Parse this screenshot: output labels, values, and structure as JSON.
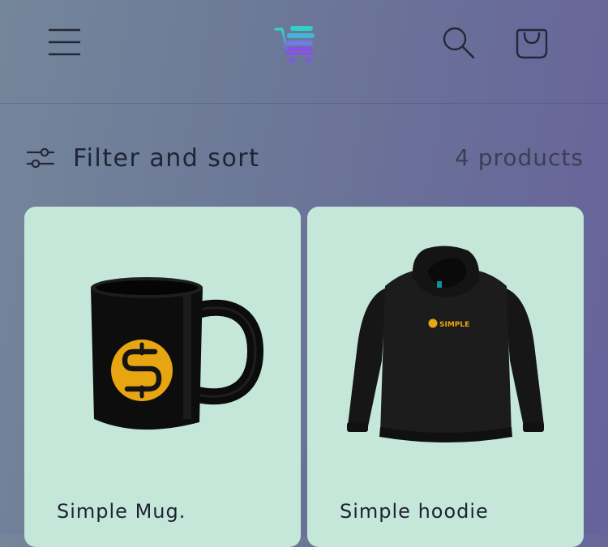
{
  "header": {
    "menu_icon": "hamburger-menu-icon",
    "logo": "shopping-cart-logo",
    "search_icon": "search-icon",
    "cart_icon": "shopping-bag-icon",
    "colors": {
      "logo_top": "#2fd4c4",
      "logo_bottom": "#8a4cf0"
    }
  },
  "toolbar": {
    "filter_icon": "sliders-icon",
    "filter_label": "Filter and sort",
    "product_count": "4 products"
  },
  "products": [
    {
      "title": "Simple Mug.",
      "image": "black-mug-with-gold-s-logo"
    },
    {
      "title": "Simple hoodie",
      "image": "black-hoodie-with-simple-logo",
      "print_text": "SIMPLE"
    }
  ],
  "colors": {
    "card_bg": "#c5e7da",
    "text": "#1d2435",
    "logo_gold": "#e8a512"
  }
}
